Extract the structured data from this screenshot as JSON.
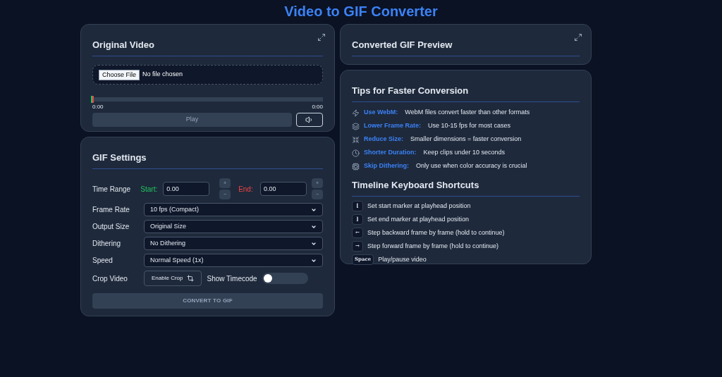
{
  "title": "Video to GIF Converter",
  "original_video": {
    "title": "Original Video",
    "file_button": "Choose File",
    "file_status": "No file chosen",
    "time_start": "0:00",
    "time_end": "0:00",
    "play_button": {
      "label": "Play",
      "disabled": true
    }
  },
  "gif_settings": {
    "title": "GIF Settings",
    "time_range": {
      "label": "Time Range",
      "start_label": "Start:",
      "start_value": "0.00",
      "end_label": "End:",
      "end_value": "0.00",
      "plus": "+",
      "minus": "−"
    },
    "selects": [
      {
        "label": "Frame Rate",
        "value": "10 fps (Compact)"
      },
      {
        "label": "Output Size",
        "value": "Original Size"
      },
      {
        "label": "Dithering",
        "value": "No Dithering"
      },
      {
        "label": "Speed",
        "value": "Normal Speed (1x)"
      }
    ],
    "crop": {
      "label": "Crop Video",
      "button": "Enable Crop"
    },
    "timecode": {
      "label": "Show Timecode",
      "on": false
    },
    "convert_button": {
      "label": "CONVERT TO GIF",
      "disabled": true
    }
  },
  "preview": {
    "title": "Converted GIF Preview"
  },
  "tips": {
    "title": "Tips for Faster Conversion",
    "items": [
      {
        "kind": "bolt",
        "name": "Use WebM:",
        "text": "WebM files convert faster than other formats"
      },
      {
        "kind": "layers",
        "name": "Lower Frame Rate:",
        "text": "Use 10-15 fps for most cases"
      },
      {
        "kind": "shrink",
        "name": "Reduce Size:",
        "text": "Smaller dimensions = faster conversion"
      },
      {
        "kind": "clock",
        "name": "Shorter Duration:",
        "text": "Keep clips under 10 seconds"
      },
      {
        "kind": "chip",
        "name": "Skip Dithering:",
        "text": "Only use when color accuracy is crucial"
      }
    ]
  },
  "shortcuts": {
    "title": "Timeline Keyboard Shortcuts",
    "items": [
      {
        "key": "[",
        "text": "Set start marker at playhead position"
      },
      {
        "key": "]",
        "text": "Set end marker at playhead position"
      },
      {
        "key": "←",
        "text": "Step backward frame by frame (hold to continue)"
      },
      {
        "key": "→",
        "text": "Step forward frame by frame (hold to continue)"
      },
      {
        "key": "Space",
        "text": "Play/pause video"
      }
    ]
  }
}
